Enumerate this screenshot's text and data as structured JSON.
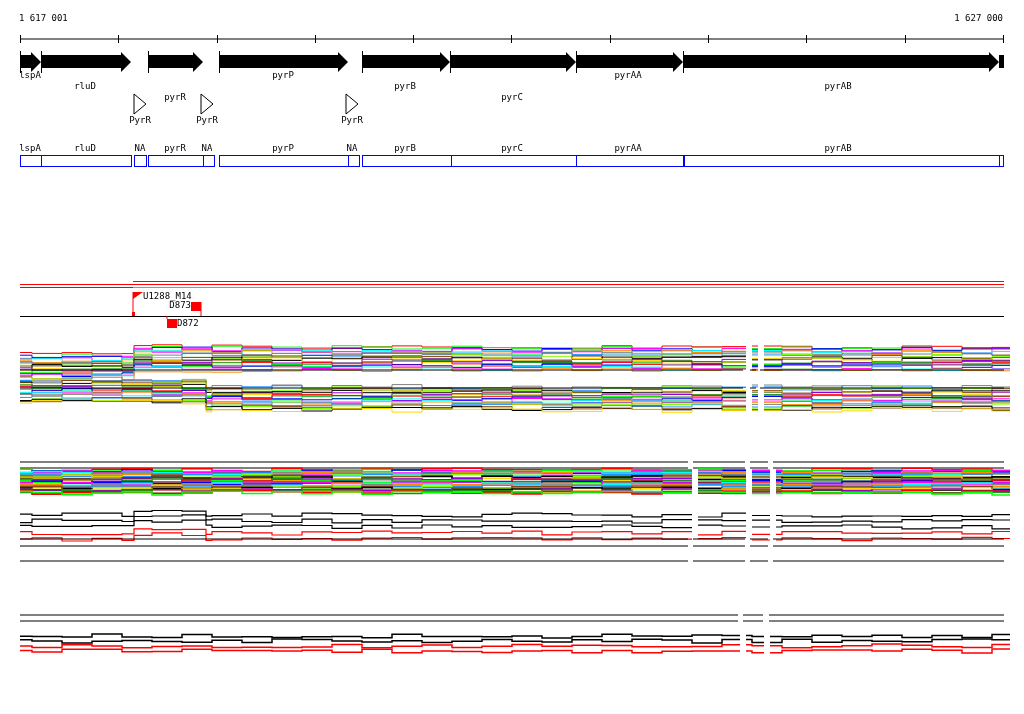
{
  "ruler": {
    "start": "1 617 001",
    "end": "1 627 000"
  },
  "genes": [
    {
      "name": "lspA"
    },
    {
      "name": "rluD"
    },
    {
      "name": "pyrR"
    },
    {
      "name": "pyrP"
    },
    {
      "name": "pyrB"
    },
    {
      "name": "pyrC"
    },
    {
      "name": "pyrAA"
    },
    {
      "name": "pyrAB"
    }
  ],
  "terminators": [
    {
      "label": "PyrR"
    },
    {
      "label": "PyrR"
    },
    {
      "label": "PyrR"
    }
  ],
  "annotations": [
    {
      "label": "lspA"
    },
    {
      "label": "rluD"
    },
    {
      "label": "NA"
    },
    {
      "label": "pyrR"
    },
    {
      "label": "NA"
    },
    {
      "label": "pyrP"
    },
    {
      "label": "NA"
    },
    {
      "label": "pyrB"
    },
    {
      "label": "pyrC"
    },
    {
      "label": "pyrAA"
    },
    {
      "label": "pyrAB"
    }
  ],
  "markers": [
    {
      "label": "U1288_M14",
      "kind": "flag"
    },
    {
      "label": "D873",
      "kind": "square"
    },
    {
      "label": "D872",
      "kind": "square"
    }
  ]
}
